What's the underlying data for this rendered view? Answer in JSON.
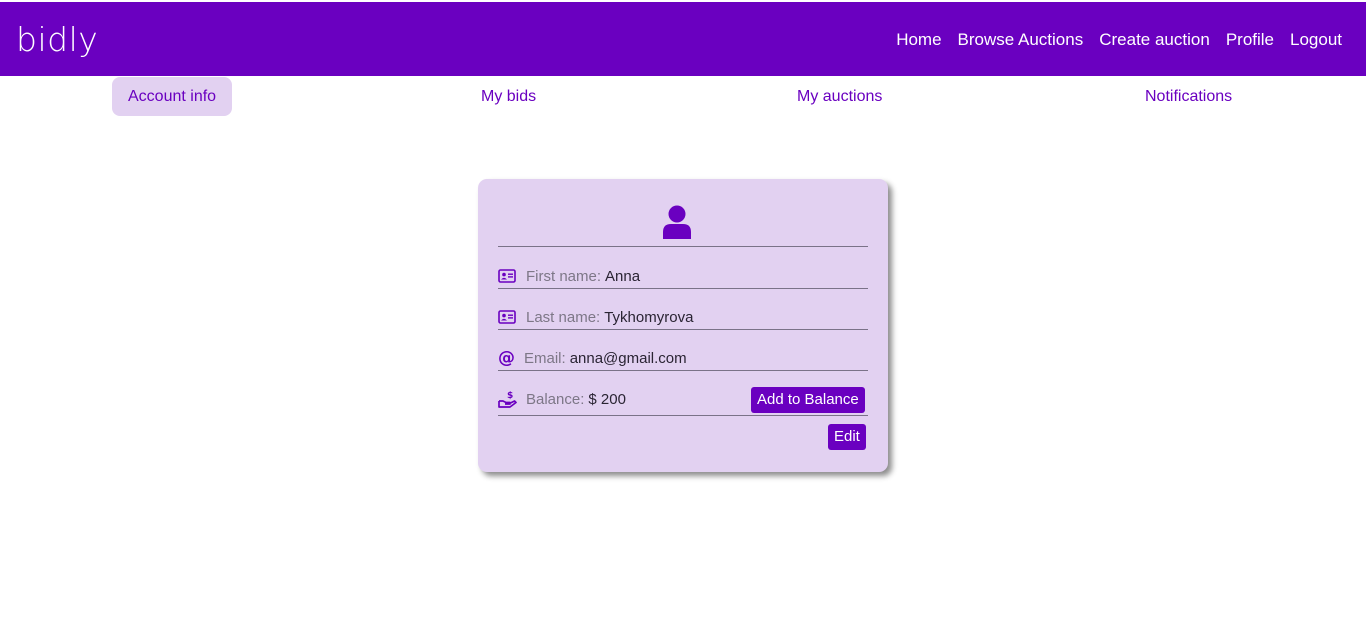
{
  "navbar": {
    "brand": "bidly",
    "links": [
      "Home",
      "Browse Auctions",
      "Create auction",
      "Profile",
      "Logout"
    ],
    "background_color": "#6a00c0"
  },
  "tabs": [
    {
      "label": "Account info",
      "active": true
    },
    {
      "label": "My bids",
      "active": false
    },
    {
      "label": "My auctions",
      "active": false
    },
    {
      "label": "Notifications",
      "active": false
    }
  ],
  "profile_card": {
    "avatar_icon": "user-icon",
    "first_name": {
      "icon": "id-card-icon",
      "label": "First name:",
      "value": "Anna"
    },
    "last_name": {
      "icon": "id-card-icon",
      "label": "Last name:",
      "value": "Tykhomyrova"
    },
    "email": {
      "icon": "at-icon",
      "label": "Email:",
      "value": "anna@gmail.com"
    },
    "balance": {
      "icon": "hand-dollar-icon",
      "label": "Balance:",
      "value": "$ 200"
    },
    "add_balance_label": "Add to Balance",
    "edit_label": "Edit",
    "background_color": "#e2d1f1",
    "accent_color": "#6a00c0"
  }
}
